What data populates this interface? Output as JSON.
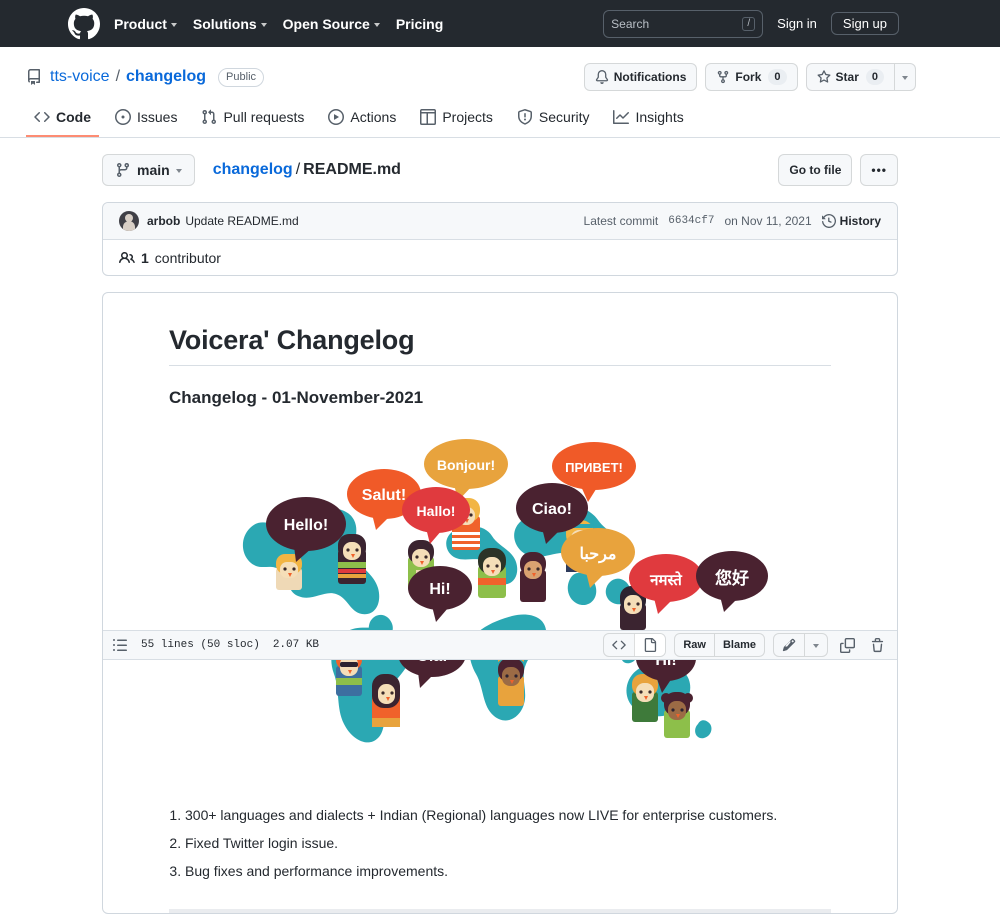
{
  "header": {
    "logo_icon": "github-mark-icon",
    "nav": [
      {
        "label": "Product",
        "has_caret": true
      },
      {
        "label": "Solutions",
        "has_caret": true
      },
      {
        "label": "Open Source",
        "has_caret": true
      },
      {
        "label": "Pricing",
        "has_caret": false
      }
    ],
    "search": {
      "placeholder": "Search",
      "shortcut": "/",
      "icon": "search-input"
    },
    "sign_in": "Sign in",
    "sign_up": "Sign up"
  },
  "repo": {
    "icon": "repo-icon",
    "owner": "tts-voice",
    "separator": "/",
    "name": "changelog",
    "visibility": "Public",
    "actions": {
      "notifications": {
        "label": "Notifications",
        "icon": "bell-icon"
      },
      "fork": {
        "label": "Fork",
        "count": "0",
        "icon": "fork-icon"
      },
      "star": {
        "label": "Star",
        "count": "0",
        "icon": "star-icon"
      },
      "star_dropdown_icon": "chevron-down-icon"
    },
    "tabs": [
      {
        "label": "Code",
        "icon": "code-icon",
        "active": true
      },
      {
        "label": "Issues",
        "icon": "issue-opened-icon",
        "active": false
      },
      {
        "label": "Pull requests",
        "icon": "git-pull-request-icon",
        "active": false
      },
      {
        "label": "Actions",
        "icon": "play-icon",
        "active": false
      },
      {
        "label": "Projects",
        "icon": "table-icon",
        "active": false
      },
      {
        "label": "Security",
        "icon": "shield-icon",
        "active": false
      },
      {
        "label": "Insights",
        "icon": "graph-icon",
        "active": false
      }
    ]
  },
  "file_nav": {
    "branch": {
      "label": "main",
      "icon": "branch-icon",
      "caret": "chevron-down-icon"
    },
    "breadcrumb": {
      "folder": "changelog",
      "separator": "/",
      "file": "README.md"
    },
    "go_to_file": "Go to file",
    "more": "•••"
  },
  "commit": {
    "avatar": "avatar",
    "author": "arbob",
    "message": "Update README.md",
    "latest_label": "Latest commit",
    "sha": "6634cf7",
    "date": "on Nov 11, 2021",
    "history": "History",
    "history_icon": "history-icon",
    "contributors": {
      "icon": "people-icon",
      "count": "1",
      "label": "contributor"
    }
  },
  "file_toolbar": {
    "list_icon": "list-unordered-icon",
    "lines": "55 lines (50 sloc)",
    "size": "2.07 KB",
    "code_view_icon": "code-icon",
    "preview_icon": "file-icon",
    "raw": "Raw",
    "blame": "Blame",
    "edit_icon": "pencil-icon",
    "edit_caret_icon": "chevron-down-icon",
    "copy_icon": "copy-icon",
    "delete_icon": "trash-icon"
  },
  "readme": {
    "title": "Voicera' Changelog",
    "subtitle": "Changelog - 01-November-2021",
    "items": [
      "300+ languages and dialects + Indian (Regional) languages now LIVE for enterprise customers.",
      "Fixed Twitter login issue.",
      "Bug fixes and performance improvements."
    ],
    "illustration": {
      "name": "world-languages-illustration",
      "map_color": "#2BA8B3",
      "bubbles": [
        {
          "text": "Hello!",
          "color": "#4A2230",
          "text_color": "#ffffff"
        },
        {
          "text": "Salut!",
          "color": "#F05A28",
          "text_color": "#ffffff"
        },
        {
          "text": "Bonjour!",
          "color": "#E8A33D",
          "text_color": "#ffffff"
        },
        {
          "text": "Hallo!",
          "color": "#E03A3E",
          "text_color": "#ffffff"
        },
        {
          "text": "Hi!",
          "color": "#4A2230",
          "text_color": "#ffffff"
        },
        {
          "text": "Ciao!",
          "color": "#4A2230",
          "text_color": "#ffffff"
        },
        {
          "text": "ПРИВЕТ!",
          "color": "#F05A28",
          "text_color": "#ffffff"
        },
        {
          "text": "مرحبا",
          "color": "#E8A33D",
          "text_color": "#ffffff"
        },
        {
          "text": "नमस्ते",
          "color": "#E03A3E",
          "text_color": "#ffffff"
        },
        {
          "text": "您好",
          "color": "#4A2230",
          "text_color": "#ffffff"
        },
        {
          "text": "Olá!",
          "color": "#4A2230",
          "text_color": "#ffffff"
        },
        {
          "text": "Hi!",
          "color": "#4A2230",
          "text_color": "#ffffff"
        }
      ]
    }
  }
}
